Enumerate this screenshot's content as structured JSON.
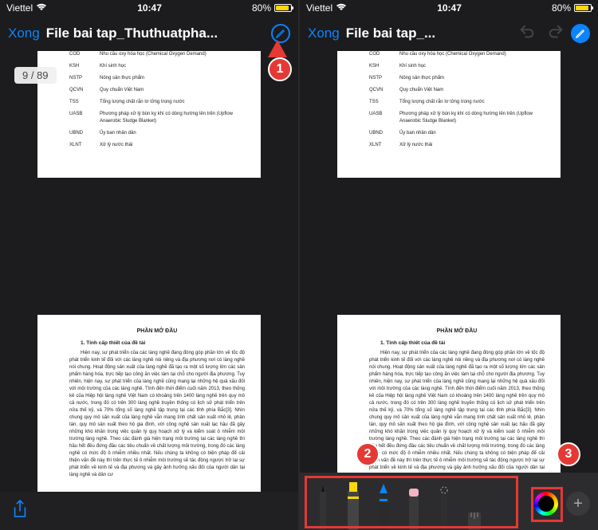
{
  "status": {
    "carrier": "Viettel",
    "time": "10:47",
    "battery_pct": "80%"
  },
  "nav": {
    "done": "Xong",
    "title_left": "File bai tap_Thuthuatpha...",
    "title_right": "File bai tap_..."
  },
  "page_counter": "9 / 89",
  "document": {
    "abbrev": [
      {
        "k": "COD",
        "v": "Nhu cầu oxy hóa học (Chemical Oxygen Demand)"
      },
      {
        "k": "KSH",
        "v": "Khí sinh học"
      },
      {
        "k": "NSTP",
        "v": "Nông sản thực phẩm"
      },
      {
        "k": "QCVN",
        "v": "Quy chuẩn Việt Nam"
      },
      {
        "k": "TSS",
        "v": "Tổng lượng chất rắn lơ lửng trong nước"
      },
      {
        "k": "UASB",
        "v": "Phương pháp xử lý bùn kỵ khí có dòng hướng lên trên (Upflow Anaerobic Sludge Blanket)"
      },
      {
        "k": "UBND",
        "v": "Ủy ban nhân dân"
      },
      {
        "k": "XLNT",
        "v": "Xử lý nước thải"
      }
    ],
    "heading": "PHẦN MỞ ĐẦU",
    "section": "1. Tính cấp thiết của đề tài",
    "body": "Hiện nay, sự phát triển của các làng nghề đang đóng góp phần lớn về tốc độ phát triển kinh tế đối với các làng nghề nói riêng và địa phương nơi có làng nghề nói chung. Hoạt động sản xuất của làng nghề đã tạo ra một số lượng lớn các sản phẩm hàng hóa, trực tiếp tạo công ăn việc làm tại chỗ cho người địa phương. Tuy nhiên, hiện nay, sự phát triển của làng nghề cũng mang lại những hệ quả xấu đối với môi trường của các làng nghề. Tính đến thời điểm cuối năm 2013, theo thống kê của Hiệp hội làng nghề Việt Nam có khoảng trên 1400 làng nghề trên quy mô cả nước, trong đó có trên 300 làng nghề truyền thống có lịch sử phát triển trên nửa thế kỷ, và 70% tổng số làng nghề tập trung tại các tỉnh phía Bắc[3]. Nhìn chung quy mô sản xuất của làng nghề vẫn mang tính chất sản xuất nhỏ lẻ, phân tán, quy mô sản xuất theo hộ gia đình, với công nghệ sản xuất lạc hậu đã gây những khó khăn trong việc quản lý quy hoạch xử lý và kiểm soát ô nhiễm môi trường làng nghề. Theo các đánh giá hiện trạng môi trường tại các làng nghề thì hầu hết đều đứng đầu các tiêu chuẩn về chất lượng môi trường, trong đó các làng nghề có mức độ ô nhiễm nhiều nhất. Nếu chúng ta không có biện pháp để cải thiện vấn đề này thì trên thực tế ô nhiễm môi trường sẽ tác động ngược trở lại sự phát triển về kinh tế và địa phương và gây ảnh hưởng xấu đối của người dân tại làng nghề và dân cư"
  },
  "callouts": {
    "one": "1",
    "two": "2",
    "three": "3"
  },
  "icons": {
    "markup": "markup-icon",
    "undo": "undo-icon",
    "redo": "redo-icon",
    "share": "share-icon",
    "plus": "+"
  },
  "tools": [
    "pen",
    "marker",
    "pencil",
    "eraser",
    "lasso",
    "ruler"
  ]
}
